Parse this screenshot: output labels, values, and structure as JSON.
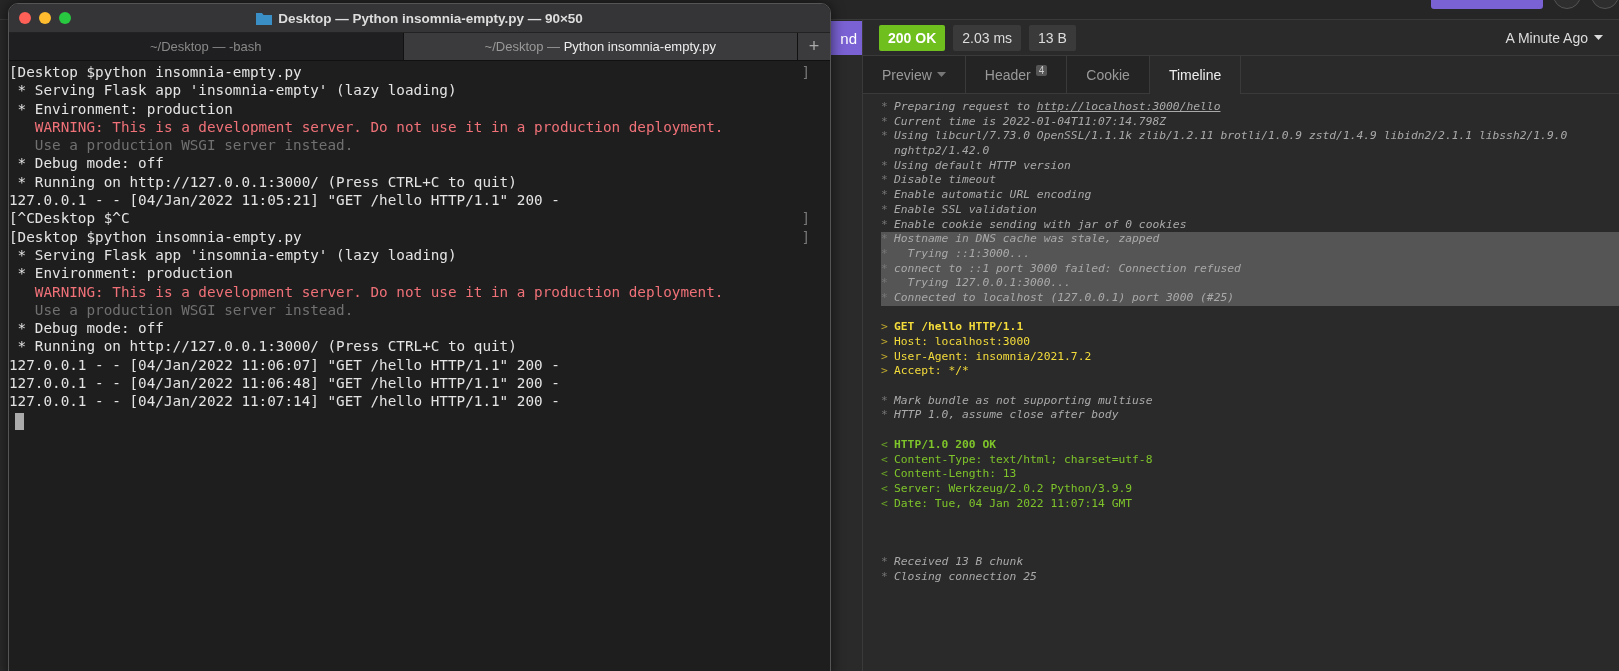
{
  "background_app": {
    "send_button": "nd"
  },
  "terminal": {
    "title": "Desktop — Python insomnia-empty.py — 90×50",
    "tabs": [
      {
        "label": "~/Desktop — -bash",
        "selected": false
      },
      {
        "dim_prefix": "~/Desktop — ",
        "main": "Python insomnia-empty.py",
        "selected": true
      }
    ],
    "new_tab": "+",
    "lines": [
      {
        "kind": "plain",
        "text": "[Desktop $python insomnia-empty.py",
        "right": "]"
      },
      {
        "kind": "plain",
        "text": " * Serving Flask app 'insomnia-empty' (lazy loading)"
      },
      {
        "kind": "plain",
        "text": " * Environment: production"
      },
      {
        "kind": "warning",
        "text": "   WARNING: This is a development server. Do not use it in a production deployment."
      },
      {
        "kind": "dim",
        "text": "   Use a production WSGI server instead."
      },
      {
        "kind": "plain",
        "text": " * Debug mode: off"
      },
      {
        "kind": "plain",
        "text": " * Running on http://127.0.0.1:3000/ (Press CTRL+C to quit)"
      },
      {
        "kind": "plain",
        "text": "127.0.0.1 - - [04/Jan/2022 11:05:21] \"GET /hello HTTP/1.1\" 200 -"
      },
      {
        "kind": "plain",
        "text": "[^CDesktop $^C",
        "right": "]"
      },
      {
        "kind": "plain",
        "text": "[Desktop $python insomnia-empty.py",
        "right": "]"
      },
      {
        "kind": "plain",
        "text": " * Serving Flask app 'insomnia-empty' (lazy loading)"
      },
      {
        "kind": "plain",
        "text": " * Environment: production"
      },
      {
        "kind": "warning",
        "text": "   WARNING: This is a development server. Do not use it in a production deployment."
      },
      {
        "kind": "dim",
        "text": "   Use a production WSGI server instead."
      },
      {
        "kind": "plain",
        "text": " * Debug mode: off"
      },
      {
        "kind": "plain",
        "text": " * Running on http://127.0.0.1:3000/ (Press CTRL+C to quit)"
      },
      {
        "kind": "plain",
        "text": "127.0.0.1 - - [04/Jan/2022 11:06:07] \"GET /hello HTTP/1.1\" 200 -"
      },
      {
        "kind": "plain",
        "text": "127.0.0.1 - - [04/Jan/2022 11:06:48] \"GET /hello HTTP/1.1\" 200 -"
      },
      {
        "kind": "plain",
        "text": "127.0.0.1 - - [04/Jan/2022 11:07:14] \"GET /hello HTTP/1.1\" 200 -"
      },
      {
        "kind": "cursor"
      }
    ]
  },
  "response": {
    "status": "200 OK",
    "time": "2.03 ms",
    "size": "13 B",
    "history": "A Minute Ago",
    "tabs": [
      {
        "label": "Preview",
        "dropdown": true,
        "selected": false
      },
      {
        "label": "Header",
        "count": "4",
        "selected": false
      },
      {
        "label": "Cookie",
        "selected": false
      },
      {
        "label": "Timeline",
        "selected": true
      }
    ],
    "timeline": [
      {
        "kind": "info",
        "prefix": "*",
        "text": "Preparing request to ",
        "link": "http://localhost:3000/hello",
        "selected": false
      },
      {
        "kind": "info",
        "prefix": "*",
        "text": "Current time is 2022-01-04T11:07:14.798Z",
        "selected": false
      },
      {
        "kind": "info",
        "prefix": "*",
        "text": "Using libcurl/7.73.0 OpenSSL/1.1.1k zlib/1.2.11 brotli/1.0.9 zstd/1.4.9 libidn2/2.1.1 libssh2/1.9.0",
        "selected": false
      },
      {
        "kind": "info",
        "text": "nghttp2/1.42.0",
        "selected": false
      },
      {
        "kind": "info",
        "prefix": "*",
        "text": "Using default HTTP version",
        "selected": false
      },
      {
        "kind": "info",
        "prefix": "*",
        "text": "Disable timeout",
        "selected": false
      },
      {
        "kind": "info",
        "prefix": "*",
        "text": "Enable automatic URL encoding",
        "selected": false
      },
      {
        "kind": "info",
        "prefix": "*",
        "text": "Enable SSL validation",
        "selected": false
      },
      {
        "kind": "info",
        "prefix": "*",
        "text": "Enable cookie sending with jar of 0 cookies",
        "selected": false
      },
      {
        "kind": "info",
        "prefix": "*",
        "text": "Hostname in DNS cache was stale, zapped",
        "selected": true
      },
      {
        "kind": "info",
        "prefix": "*",
        "text": "  Trying ::1:3000...",
        "selected": true
      },
      {
        "kind": "info",
        "prefix": "*",
        "text": "connect to ::1 port 3000 failed: Connection refused",
        "selected": true
      },
      {
        "kind": "info",
        "prefix": "*",
        "text": "  Trying 127.0.0.1:3000...",
        "selected": true
      },
      {
        "kind": "info",
        "prefix": "*",
        "text": "Connected to localhost (127.0.0.1) port 3000 (#25)",
        "selected": true
      },
      {
        "kind": "blank"
      },
      {
        "kind": "request",
        "prefix": ">",
        "text": "GET /hello HTTP/1.1",
        "bold": true,
        "selected": false
      },
      {
        "kind": "request",
        "prefix": ">",
        "text": "Host: localhost:3000",
        "selected": false
      },
      {
        "kind": "request",
        "prefix": ">",
        "text": "User-Agent: insomnia/2021.7.2",
        "selected": false
      },
      {
        "kind": "request",
        "prefix": ">",
        "text": "Accept: */*",
        "selected": false
      },
      {
        "kind": "blank"
      },
      {
        "kind": "info",
        "prefix": "*",
        "text": "Mark bundle as not supporting multiuse",
        "selected": false
      },
      {
        "kind": "info",
        "prefix": "*",
        "text": "HTTP 1.0, assume close after body",
        "selected": false
      },
      {
        "kind": "blank"
      },
      {
        "kind": "response",
        "prefix": "<",
        "text": "HTTP/1.0 200 OK",
        "bold": true,
        "selected": false
      },
      {
        "kind": "response",
        "prefix": "<",
        "text": "Content-Type: text/html; charset=utf-8",
        "selected": false
      },
      {
        "kind": "response",
        "prefix": "<",
        "text": "Content-Length: 13",
        "selected": false
      },
      {
        "kind": "response",
        "prefix": "<",
        "text": "Server: Werkzeug/2.0.2 Python/3.9.9",
        "selected": false
      },
      {
        "kind": "response",
        "prefix": "<",
        "text": "Date: Tue, 04 Jan 2022 11:07:14 GMT",
        "selected": false
      },
      {
        "kind": "blank"
      },
      {
        "kind": "blank"
      },
      {
        "kind": "blank"
      },
      {
        "kind": "info",
        "prefix": "*",
        "text": "Received 13 B chunk",
        "selected": false
      },
      {
        "kind": "info",
        "prefix": "*",
        "text": "Closing connection 25",
        "selected": false
      }
    ]
  }
}
